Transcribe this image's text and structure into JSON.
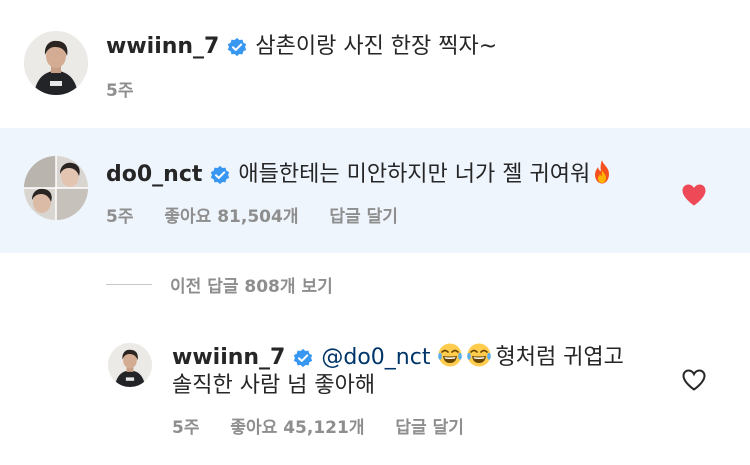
{
  "caption": {
    "username": "wwiinn_7",
    "text": "삼촌이랑 사진 한장 찍자~",
    "time": "5주"
  },
  "comment": {
    "username": "do0_nct",
    "text": "애들한테는 미안하지만 너가 젤 귀여워",
    "emoji": "fire-emoji",
    "time": "5주",
    "likes": "좋아요 81,504개",
    "reply_label": "답글 달기",
    "liked": true,
    "heart_color": "#ed4956"
  },
  "view_replies": {
    "label": "이전 답글 808개 보기"
  },
  "reply": {
    "username": "wwiinn_7",
    "mention": "@do0_nct",
    "emojis": [
      "tears-of-joy-emoji",
      "tears-of-joy-emoji"
    ],
    "text_line1": "형처럼 귀엽고",
    "text_line2": "솔직한 사람 넘 좋아해",
    "time": "5주",
    "likes": "좋아요 45,121개",
    "reply_label": "답글 달기",
    "liked": false
  },
  "colors": {
    "highlight_bg": "#eff5fd",
    "verified_badge": "#3897f0",
    "meta_text": "#8e8e8e",
    "mention": "#003569"
  }
}
